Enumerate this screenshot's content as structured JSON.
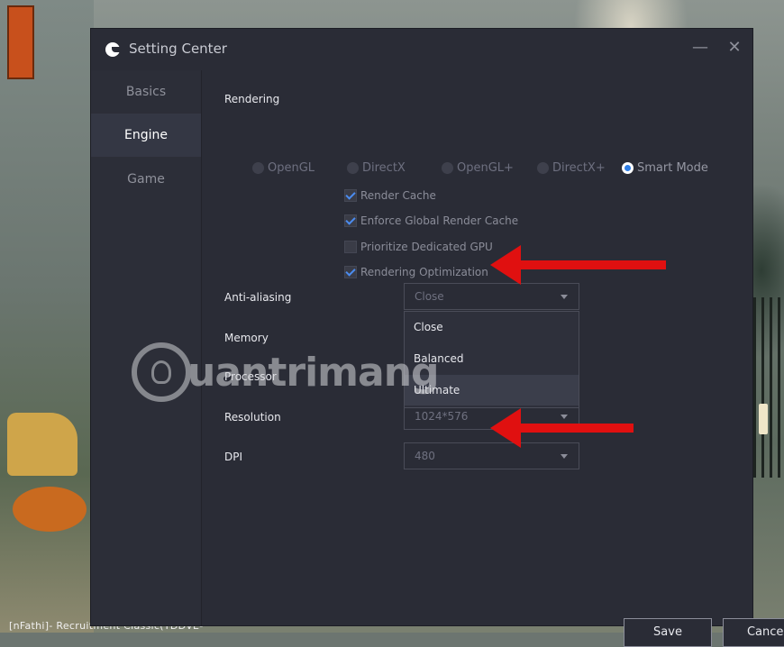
{
  "background": {
    "bottom_text": "[nFathi]- Recruitment Classic(TDDVE-",
    "icon": "game-scene"
  },
  "window": {
    "title": "Setting Center",
    "logo_icon": "app-logo-icon",
    "minimize": "—",
    "close": "✕"
  },
  "sidebar": {
    "items": [
      {
        "label": "Basics",
        "active": false
      },
      {
        "label": "Engine",
        "active": true
      },
      {
        "label": "Game",
        "active": false
      }
    ]
  },
  "rendering": {
    "label": "Rendering",
    "modes": [
      {
        "label": "OpenGL",
        "selected": false
      },
      {
        "label": "DirectX",
        "selected": false
      },
      {
        "label": "OpenGL+",
        "selected": false
      },
      {
        "label": "DirectX+",
        "selected": false
      },
      {
        "label": "Smart Mode",
        "selected": true
      }
    ],
    "checkboxes": [
      {
        "label": "Render Cache",
        "checked": true
      },
      {
        "label": "Enforce Global Render Cache",
        "checked": true
      },
      {
        "label": "Prioritize Dedicated GPU",
        "checked": false
      },
      {
        "label": "Rendering Optimization",
        "checked": true
      }
    ]
  },
  "anti_aliasing": {
    "label": "Anti-aliasing",
    "value": "Close",
    "options": [
      "Close",
      "Balanced",
      "Ultimate"
    ],
    "highlighted": "Ultimate"
  },
  "memory": {
    "label": "Memory"
  },
  "processor": {
    "label": "Processor"
  },
  "resolution": {
    "label": "Resolution",
    "value": "1024*576"
  },
  "dpi": {
    "label": "DPI",
    "value": "480"
  },
  "buttons": {
    "save": "Save",
    "cancel": "Cancel"
  },
  "watermark": {
    "text": "uantrimang"
  },
  "colors": {
    "accent": "#2f7ee6",
    "arrow": "#e01010",
    "dialog_bg": "#2a2c36"
  }
}
